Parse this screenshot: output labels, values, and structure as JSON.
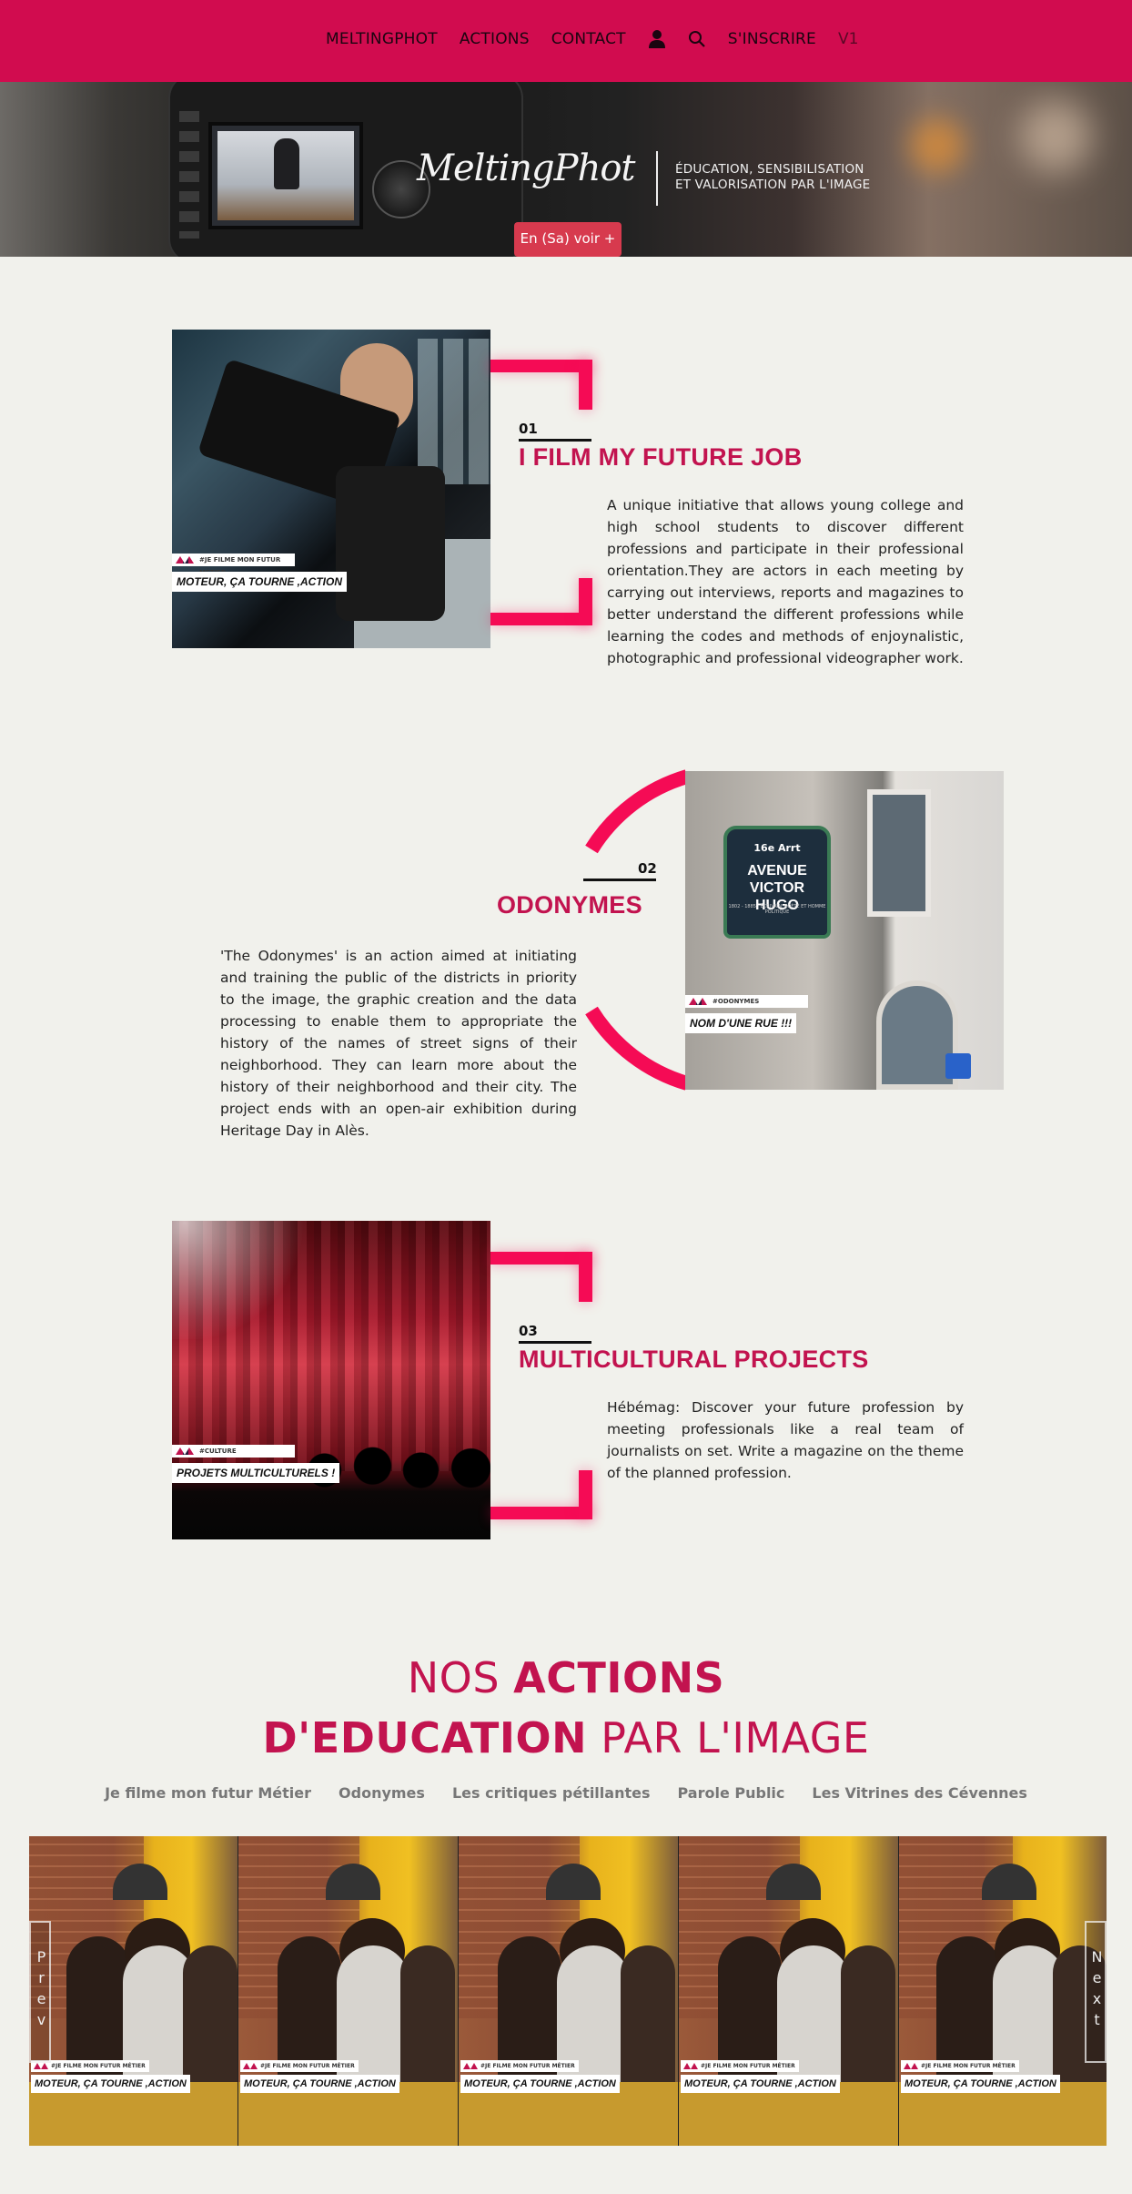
{
  "nav": {
    "items": [
      "MELTINGPHOT",
      "ACTIONS",
      "CONTACT"
    ],
    "signup": "S'INSCRIRE",
    "version": "V1"
  },
  "hero": {
    "brand": "MeltingPhot",
    "tagline_1": "ÉDUCATION, SENSIBILISATION",
    "tagline_2": "ET VALORISATION PAR L'IMAGE",
    "cta": "En (Sa) voir +"
  },
  "sections": [
    {
      "number": "01",
      "title": "I FILM MY FUTURE JOB",
      "body": "A unique initiative that allows young college and high school students to discover different professions and participate in their professional orientation.They are actors in each meeting by carrying out interviews, reports and magazines to better understand the different professions while learning the codes and methods of enjoynalistic, photographic and professional videographer work.",
      "badge_top": "#JE FILME MON FUTUR MÉTIER",
      "badge_bottom": "MOTEUR, ÇA TOURNE ,ACTION"
    },
    {
      "number": "02",
      "title": "ODONYMES",
      "body": "'The Odonymes' is an action aimed at initiating and training the public of the districts in priority to the image, the graphic creation and the data processing to enable them to appropriate the history of the names of street signs of their neighborhood. They can learn more about the history of their neighborhood and their city. The project ends with an open-air exhibition during Heritage Day in Alès.",
      "badge_top": "#ODONYMES",
      "badge_bottom": "NOM D'UNE RUE !!!",
      "sign_arr": "16e Arrt",
      "sign_name_1": "AVENUE",
      "sign_name_2": "VICTOR HUGO",
      "sign_small": "1802 - 1885 · ÉCRIVAIN, POÈTE ET HOMME POLITIQUE"
    },
    {
      "number": "03",
      "title": "MULTICULTURAL PROJECTS",
      "body": "Hébémag: Discover your future profession by meeting professionals like a real team of journalists on set. Write a magazine on the theme of the planned profession.",
      "badge_top": "#CULTURE",
      "badge_bottom": "PROJETS MULTICULTURELS !"
    }
  ],
  "actions": {
    "title_l1_a": "NOS ",
    "title_l1_b": "ACTIONS",
    "title_l2_a": "D'EDUCATION",
    "title_l2_b": " PAR L'IMAGE",
    "tabs": [
      "Je filme mon futur Métier",
      "Odonymes",
      "Les critiques pétillantes",
      "Parole Public",
      "Les Vitrines des Cévennes"
    ],
    "slide_badge_top": "#JE FILME MON FUTUR MÉTIER",
    "slide_badge_bottom": "MOTEUR, ÇA TOURNE ,ACTION",
    "prev": "Prev",
    "next": "Next"
  },
  "colors": {
    "brand": "#d10c4f",
    "accent": "#f50b55",
    "title": "#c2134f",
    "background": "#f1f1ec"
  }
}
